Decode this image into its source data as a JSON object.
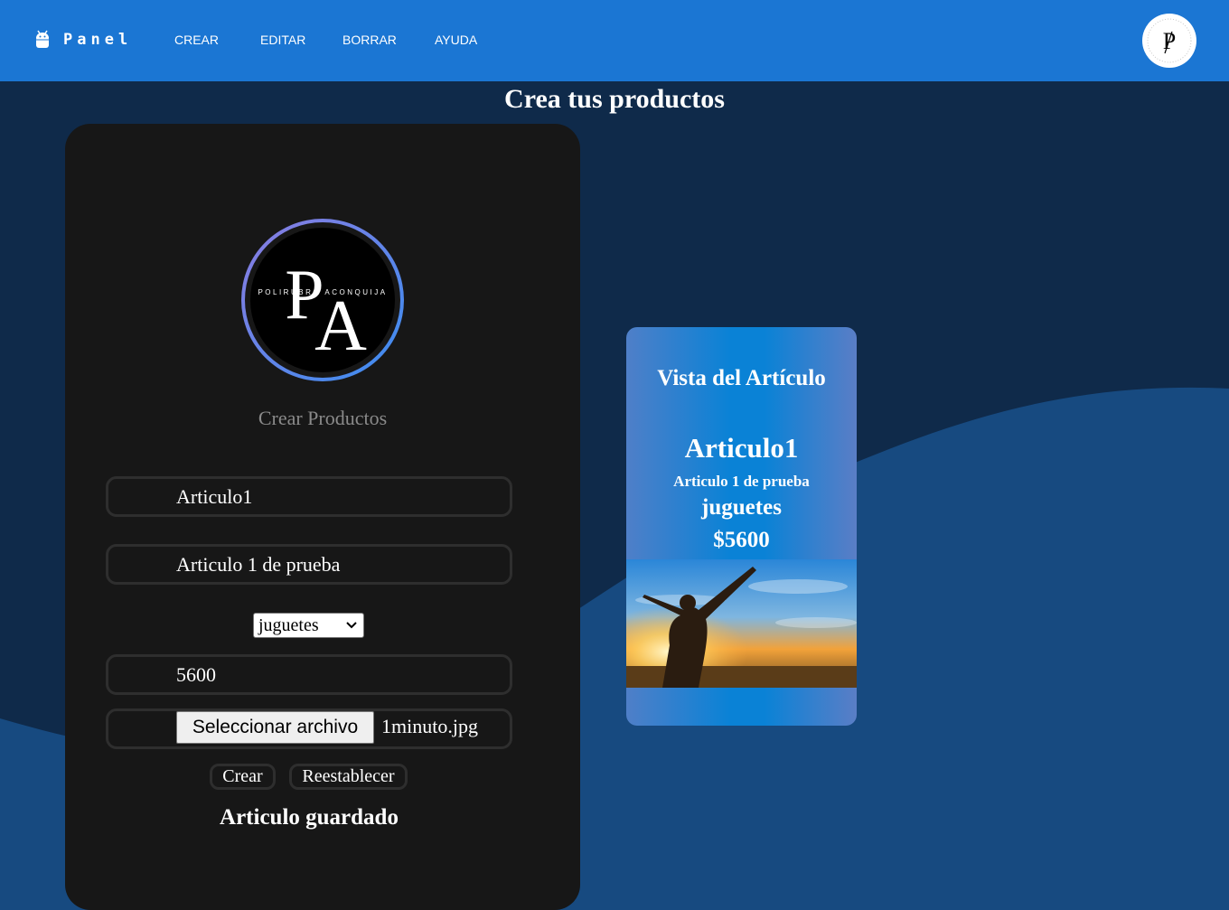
{
  "navbar": {
    "brand": "Panel",
    "items": [
      {
        "label": "CREAR"
      },
      {
        "label": "EDITAR"
      },
      {
        "label": "BORRAR"
      },
      {
        "label": "AYUDA"
      }
    ],
    "avatar_icon": "logo-pa-icon"
  },
  "page": {
    "title": "Crea tus productos"
  },
  "form": {
    "logo_icon": "logo-pa-icon",
    "logo_text": "POLIRUBRO ACONQUIJA",
    "subtitle": "Crear Productos",
    "name_value": "Articulo1",
    "description_value": "Articulo 1 de prueba",
    "category_selected": "juguetes",
    "price_value": "5600",
    "file_button_label": "Seleccionar archivo",
    "file_name": "1minuto.jpg",
    "create_label": "Crear",
    "reset_label": "Reestablecer",
    "status_message": "Articulo guardado"
  },
  "preview": {
    "heading": "Vista del Artículo",
    "name": "Articulo1",
    "description": "Articulo 1 de prueba",
    "category": "juguetes",
    "price": "$5600",
    "image_icon": "sunset-person-photo"
  },
  "colors": {
    "navbar": "#1b76d3",
    "background": "#0f2a4a",
    "wave": "#174a80",
    "card": "#171717",
    "preview_accent": "#0a82d6"
  }
}
